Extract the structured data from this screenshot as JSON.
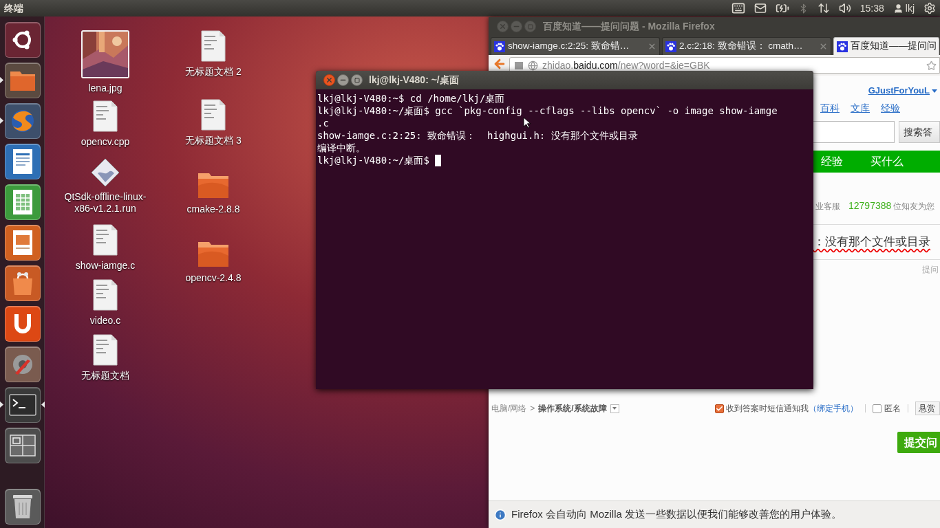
{
  "top_bar": {
    "app_title": "终端",
    "clock": "15:38",
    "user": "lkj"
  },
  "launcher": {
    "items": [
      {
        "kind": "dash",
        "running": false,
        "active": false
      },
      {
        "kind": "files",
        "running": true,
        "active": false
      },
      {
        "kind": "browser",
        "running": true,
        "active": false
      },
      {
        "kind": "writer",
        "running": false,
        "active": false
      },
      {
        "kind": "calc",
        "running": false,
        "active": false
      },
      {
        "kind": "impress",
        "running": false,
        "active": false
      },
      {
        "kind": "software",
        "running": false,
        "active": false
      },
      {
        "kind": "cloud",
        "running": false,
        "active": false
      },
      {
        "kind": "settings",
        "running": false,
        "active": false
      },
      {
        "kind": "terminal",
        "running": true,
        "active": true
      },
      {
        "kind": "workspaces",
        "running": false,
        "active": false
      }
    ],
    "trash": {
      "kind": "trash",
      "running": false,
      "active": false
    }
  },
  "desktop_icons": {
    "column_1": [
      {
        "label": "lena.jpg",
        "kind": "picture"
      },
      {
        "label": "opencv.cpp",
        "kind": "text-file"
      },
      {
        "label": "QtSdk-offline-linux-x86-v1.2.1.run",
        "kind": "package"
      },
      {
        "label": "show-iamge.c",
        "kind": "text-file"
      },
      {
        "label": "video.c",
        "kind": "text-file"
      },
      {
        "label": "无标题文档",
        "kind": "text-file"
      }
    ],
    "column_2": [
      {
        "label": "无标题文档 2",
        "kind": "text-file"
      },
      {
        "label": "无标题文档 3",
        "kind": "text-file"
      },
      {
        "label": "cmake-2.8.8",
        "kind": "folder"
      },
      {
        "label": "opencv-2.4.8",
        "kind": "folder"
      }
    ]
  },
  "firefox": {
    "title": "百度知道——提问问题 - Mozilla Firefox",
    "focused": false,
    "tabs": [
      {
        "label": "show-iamge.c:2:25: 致命错…",
        "selected": false
      },
      {
        "label": "2.c:2:18: 致命错误： cmath…",
        "selected": false
      },
      {
        "label": "百度知道——提问问",
        "selected": true
      }
    ],
    "url": "zhidao.**baidu.com**/new?word=&ie=GBK",
    "page": {
      "user_link": "GJustForYouL",
      "nav_links": [
        "百科",
        "文库",
        "经验"
      ],
      "search_button": "搜索答",
      "green_nav": [
        "经验",
        "买什么"
      ],
      "stats": {
        "prefix": "业客服",
        "count": "12797388",
        "suffix": "位知友为您"
      },
      "question_value": "：没有那个文件或目录",
      "hint": "提问",
      "category": {
        "path": "电脑/网络",
        "separator": ">",
        "current": "操作系统/系统故障"
      },
      "sms_notify": {
        "label": "收到答案时短信通知我",
        "link": "（绑定手机）",
        "checked": true
      },
      "anonymous": {
        "label": "匿名",
        "checked": false
      },
      "reward_button": "悬赏",
      "submit_button": "提交问"
    },
    "notification": "Firefox 会自动向 Mozilla 发送一些数据以便我们能够改善您的用户体验。"
  },
  "terminal": {
    "title": "lkj@lkj-V480: ~/桌面",
    "focused": true,
    "cursor": true,
    "lines": [
      "lkj@lkj-V480:~$ cd /home/lkj/桌面",
      "lkj@lkj-V480:~/桌面$ gcc `pkg-config --cflags --libs opencv` -o image show-iamge",
      ".c",
      "show-iamge.c:2:25: 致命错误：  highgui.h: 没有那个文件或目录",
      "编译中断。",
      "lkj@lkj-V480:~/桌面$ "
    ]
  }
}
